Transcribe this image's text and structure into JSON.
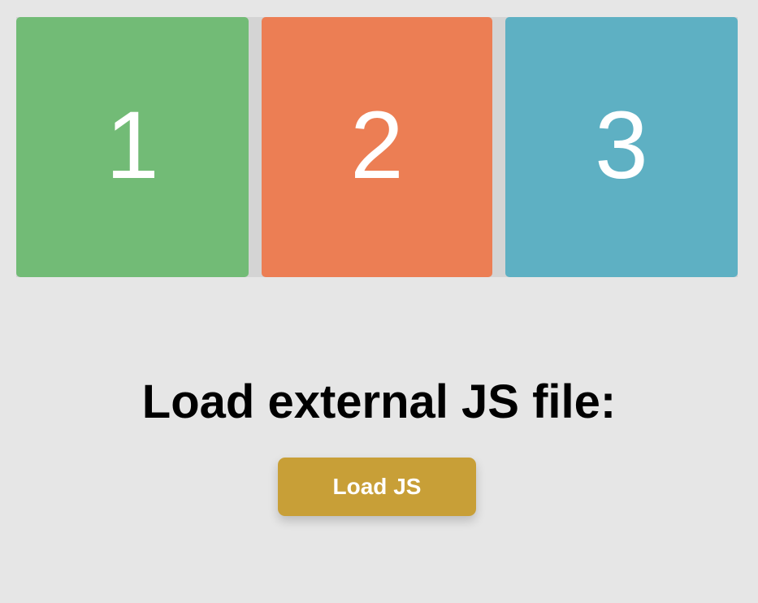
{
  "tiles": [
    {
      "label": "1",
      "color": "#72bb76"
    },
    {
      "label": "2",
      "color": "#ec7e54"
    },
    {
      "label": "3",
      "color": "#5eb0c3"
    }
  ],
  "heading": "Load external JS file:",
  "button": {
    "label": "Load JS",
    "color": "#c89f37"
  }
}
